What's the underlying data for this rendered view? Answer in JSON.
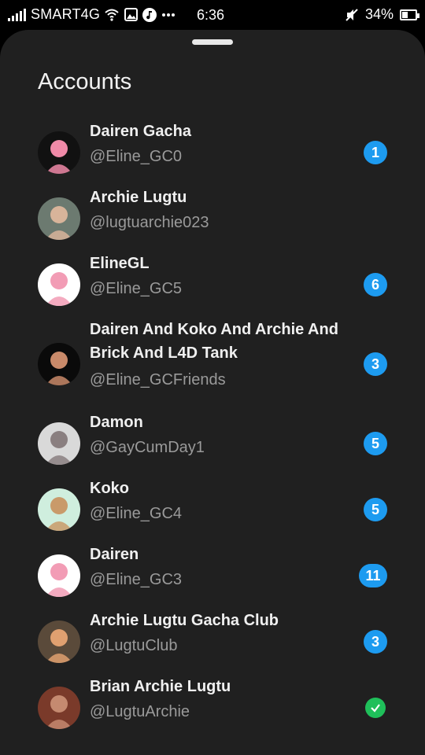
{
  "status_bar": {
    "carrier": "SMART4G",
    "time": "6:36",
    "battery": "34%"
  },
  "sheet": {
    "title": "Accounts"
  },
  "accounts": [
    {
      "name": "Dairen Gacha",
      "handle": "@Eline_GC0",
      "badge": "1",
      "avatar_colors": [
        "#111111",
        "#f08aa8"
      ]
    },
    {
      "name": "Archie Lugtu",
      "handle": "@lugtuarchie023",
      "badge": "",
      "avatar_colors": [
        "#6c7a70",
        "#d8b49a"
      ]
    },
    {
      "name": "ElineGL",
      "handle": "@Eline_GC5",
      "badge": "6",
      "avatar_colors": [
        "#ffffff",
        "#f29cb5"
      ]
    },
    {
      "name": "Dairen And Koko And Archie And Brick And L4D Tank",
      "handle": "@Eline_GCFriends",
      "badge": "3",
      "avatar_colors": [
        "#0a0a0a",
        "#c98a6a"
      ]
    },
    {
      "name": "Damon",
      "handle": "@GayCumDay1",
      "badge": "5",
      "avatar_colors": [
        "#d9d9d9",
        "#8a7f80"
      ]
    },
    {
      "name": "Koko",
      "handle": "@Eline_GC4",
      "badge": "5",
      "avatar_colors": [
        "#cfeede",
        "#c99a6a"
      ]
    },
    {
      "name": "Dairen",
      "handle": "@Eline_GC3",
      "badge": "11",
      "avatar_colors": [
        "#ffffff",
        "#f29cb5"
      ]
    },
    {
      "name": "Archie Lugtu Gacha Club",
      "handle": "@LugtuClub",
      "badge": "3",
      "avatar_colors": [
        "#5a4a3a",
        "#e0a070"
      ]
    },
    {
      "name": "Brian Archie Lugtu",
      "handle": "@LugtuArchie",
      "badge": "verified",
      "avatar_colors": [
        "#7a3a2a",
        "#c58a70"
      ]
    }
  ],
  "colors": {
    "sheet_bg": "#202020",
    "badge_blue": "#1d9bf0",
    "check_green": "#1fbf5a"
  }
}
